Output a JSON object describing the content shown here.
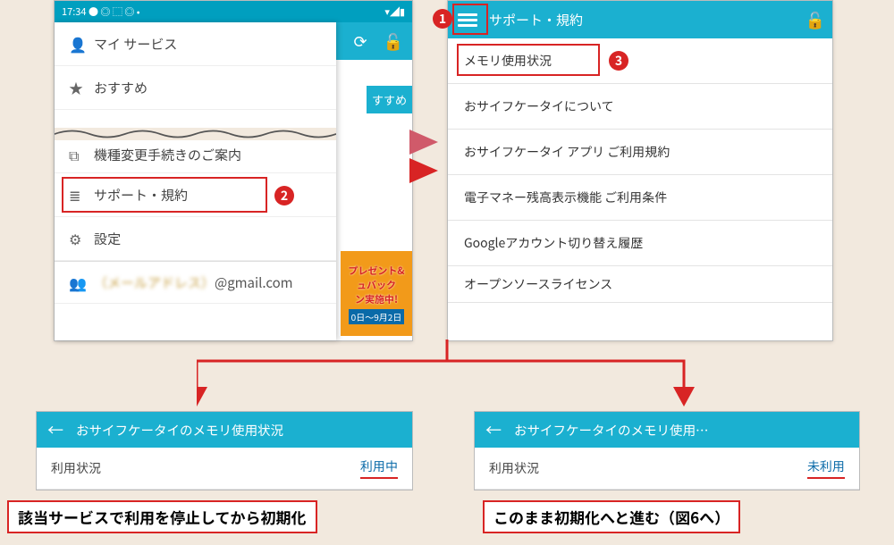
{
  "colors": {
    "accent": "#1bb0d0",
    "danger": "#d82424",
    "link": "#0a6aa8"
  },
  "left": {
    "statusbar": {
      "time": "17:34",
      "left_icons": "● ◎ ⬚ ◎ •",
      "right_icons": "▾◢▮"
    },
    "actions": {
      "refresh": "⟳",
      "lock": "🔓"
    },
    "peek_tab": "すすめ",
    "drawer": {
      "items": [
        {
          "icon": "👤",
          "label": "マイ サービス"
        },
        {
          "icon": "★",
          "label": "おすすめ"
        },
        {
          "icon": "⧉",
          "label": "機種変更手続きのご案内"
        },
        {
          "icon": "≣",
          "label": "サポート・規約"
        },
        {
          "icon": "⚙",
          "label": "設定"
        }
      ],
      "account_prefix": "（メールアドレス）",
      "account_domain": "@gmail.com",
      "account_icon": "👥"
    },
    "promo": {
      "l1": "プレゼント&",
      "l2": "ュバック",
      "l3": "ン実施中!",
      "l4": "0日〜9月2日"
    },
    "callout2": "2"
  },
  "right": {
    "title": "サポート・規約",
    "lock_icon": "🔓",
    "callout1": "1",
    "callout3": "3",
    "list": [
      "メモリ使用状況",
      "おサイフケータイについて",
      "おサイフケータイ アプリ ご利用規約",
      "電子マネー残高表示機能 ご利用条件",
      "Googleアカウント切り替え履歴",
      "オープンソースライセンス"
    ]
  },
  "bottom_left": {
    "back": "←",
    "title": "おサイフケータイのメモリ使用状況",
    "usage_label": "利用状況",
    "usage_value": "利用中",
    "caption": "該当サービスで利用を停止してから初期化"
  },
  "bottom_right": {
    "back": "←",
    "title": "おサイフケータイのメモリ使用…",
    "usage_label": "利用状況",
    "usage_value": "未利用",
    "caption": "このまま初期化へと進む（図6へ）"
  }
}
